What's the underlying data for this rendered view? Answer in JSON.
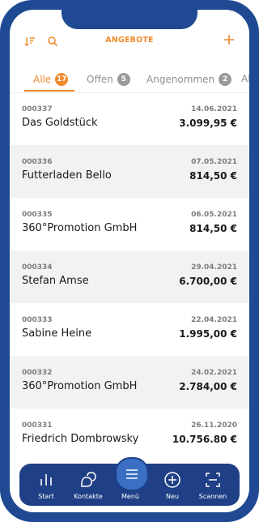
{
  "header": {
    "title": "ANGEBOTE"
  },
  "tabs": [
    {
      "label": "Alle",
      "count": "17"
    },
    {
      "label": "Offen",
      "count": "5"
    },
    {
      "label": "Angenommen",
      "count": "2"
    },
    {
      "label": "Ab"
    }
  ],
  "offers": [
    {
      "number": "000337",
      "date": "14.06.2021",
      "name": "Das Goldstück",
      "amount": "3.099,95 €"
    },
    {
      "number": "000336",
      "date": "07.05.2021",
      "name": "Futterladen Bello",
      "amount": "814,50 €"
    },
    {
      "number": "000335",
      "date": "06.05.2021",
      "name": "360°Promotion GmbH",
      "amount": "814,50 €"
    },
    {
      "number": "000334",
      "date": "29.04.2021",
      "name": "Stefan Amse",
      "amount": "6.700,00 €"
    },
    {
      "number": "000333",
      "date": "22.04.2021",
      "name": "Sabine Heine",
      "amount": "1.995,00 €"
    },
    {
      "number": "000332",
      "date": "24.02.2021",
      "name": "360°Promotion GmbH",
      "amount": "2.784,00 €"
    },
    {
      "number": "000331",
      "date": "26.11.2020",
      "name": "Friedrich Dombrowsky",
      "amount": "10.756.80 €"
    }
  ],
  "nav": {
    "start": "Start",
    "contacts": "Kontakte",
    "menu": "Menü",
    "new": "Neu",
    "scan": "Scannen"
  },
  "colors": {
    "accent": "#f08a2c",
    "frame": "#1f4a93",
    "nav": "#1f3f86"
  },
  "icons": [
    "sort-icon",
    "search-icon",
    "plus-icon",
    "chart-icon",
    "contacts-icon",
    "menu-icon",
    "plus-circle-icon",
    "scan-icon"
  ]
}
